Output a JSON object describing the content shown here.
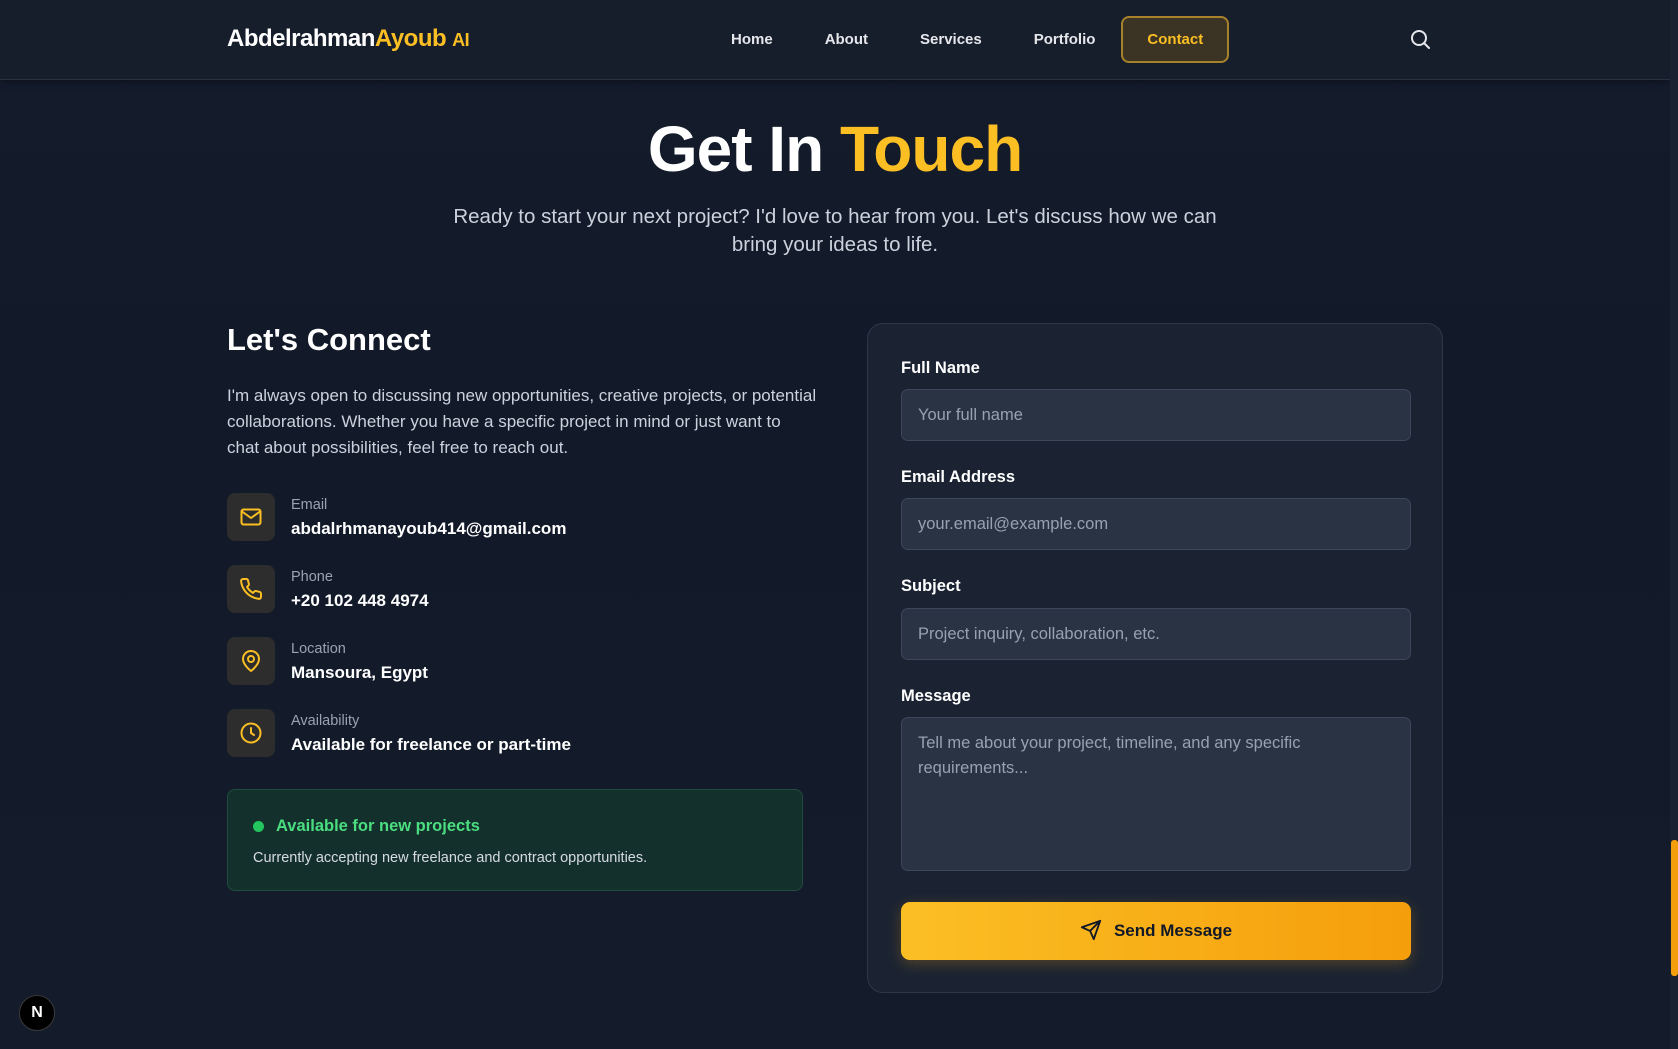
{
  "nav": {
    "logo": {
      "part1": "Abdelrahman",
      "part2": "Ayoub",
      "part3": "AI"
    },
    "links": [
      {
        "label": "Home"
      },
      {
        "label": "About"
      },
      {
        "label": "Services"
      },
      {
        "label": "Portfolio"
      },
      {
        "label": "Contact"
      }
    ],
    "active": "Contact",
    "search_icon": "search-icon"
  },
  "hero": {
    "title_white": "Get In",
    "title_accent": "Touch",
    "subtitle": "Ready to start your next project? I'd love to hear from you. Let's discuss how we can bring your ideas to life."
  },
  "connect": {
    "title": "Let's Connect",
    "description": "I'm always open to discussing new opportunities, creative projects, or potential collaborations. Whether you have a specific project in mind or just want to chat about possibilities, feel free to reach out.",
    "items": [
      {
        "icon": "mail-icon",
        "label": "Email",
        "value": "abdalrhmanayoub414@gmail.com"
      },
      {
        "icon": "phone-icon",
        "label": "Phone",
        "value": "+20 102 448 4974"
      },
      {
        "icon": "location-pin-icon",
        "label": "Location",
        "value": "Mansoura, Egypt"
      },
      {
        "icon": "clock-icon",
        "label": "Availability",
        "value": "Available for freelance or part-time"
      }
    ],
    "availability_card": {
      "title": "Available for new projects",
      "description": "Currently accepting new freelance and contract opportunities."
    }
  },
  "form": {
    "fields": [
      {
        "label": "Full Name",
        "placeholder": "Your full name"
      },
      {
        "label": "Email Address",
        "placeholder": "your.email@example.com"
      },
      {
        "label": "Subject",
        "placeholder": "Project inquiry, collaboration, etc."
      },
      {
        "label": "Message",
        "placeholder": "Tell me about your project, timeline, and any specific requirements..."
      }
    ],
    "submit_label": "Send Message",
    "submit_icon": "send-icon"
  },
  "badge": {
    "letter": "N"
  },
  "colors": {
    "accent": "#fbbf24",
    "background": "#141b2b",
    "success": "#22c55e"
  }
}
